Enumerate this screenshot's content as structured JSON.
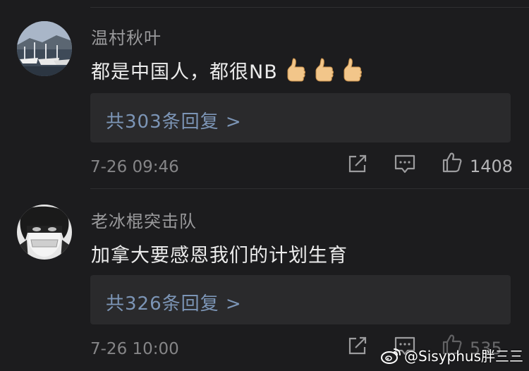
{
  "comments": [
    {
      "username": "温村秋叶",
      "text": "都是中国人，都很NB",
      "emoji": [
        "thumbs-up-icon",
        "thumbs-up-icon",
        "thumbs-up-icon"
      ],
      "replies_label": "共303条回复 >",
      "timestamp": "7-26 09:46",
      "like_count": "1408"
    },
    {
      "username": "老冰棍突击队",
      "text": "加拿大要感恩我们的计划生育",
      "replies_label": "共326条回复 >",
      "timestamp": "7-26 10:00",
      "like_count": "535"
    }
  ],
  "watermark": {
    "text": "@Sisyphus胖三三",
    "icon": "weibo-icon"
  },
  "colors": {
    "background": "#1c1c1e",
    "reply_box": "#2a2a2c",
    "link": "#7c95b6",
    "username": "#9a9a9c"
  }
}
